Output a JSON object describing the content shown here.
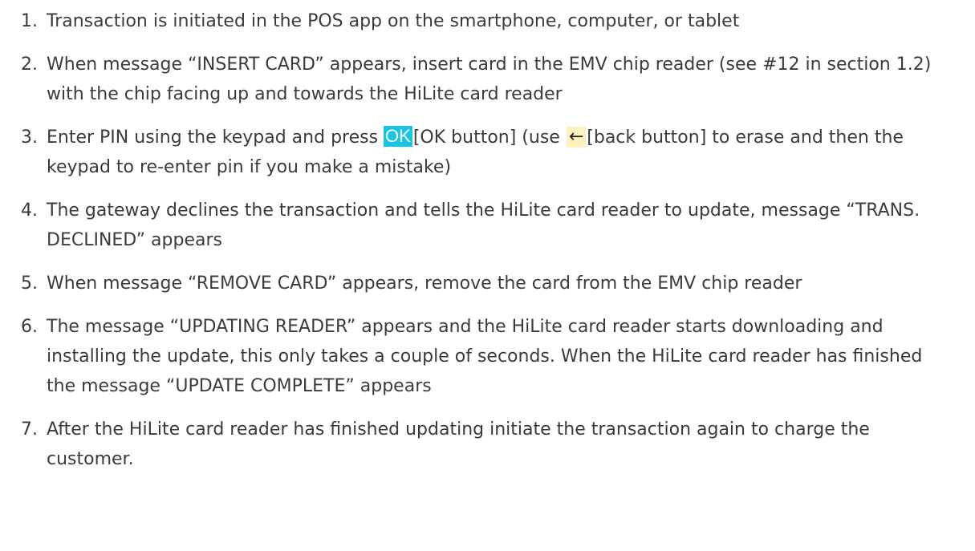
{
  "steps": [
    {
      "number": "1.",
      "text": "Transaction is initiated in the POS app on the smartphone, computer, or tablet"
    },
    {
      "number": "2.",
      "text": "When message “INSERT CARD” appears, insert card in the EMV chip reader (see #12 in section 1.2)  with the chip facing up and towards the HiLite card reader"
    },
    {
      "number": "3.",
      "text_before_ok": "Enter PIN using the keypad and press ",
      "ok_icon_label": "OK",
      "text_after_ok": "[OK button] (use",
      "back_icon_glyph": "←",
      "text_after_back": "[back button] to erase and then the keypad to re-enter pin if you make a mistake)"
    },
    {
      "number": "4.",
      "text": "The gateway declines the transaction and tells the HiLite card reader to update, message “TRANS. DECLINED” appears"
    },
    {
      "number": "5.",
      "text": "When message “REMOVE CARD” appears, remove the card from the EMV chip reader"
    },
    {
      "number": "6.",
      "text": "The message “UPDATING READER” appears and the HiLite card reader starts downloading and installing the update, this only takes a couple of seconds. When the HiLite card reader has finished the message “UPDATE COMPLETE” appears"
    },
    {
      "number": "7.",
      "text": "After the HiLite card reader has finished updating initiate the transaction again to charge the customer."
    }
  ],
  "colors": {
    "text": "#3b3b3b",
    "ok_icon_bg": "#16c6e4",
    "back_icon_bg": "#fff1bf"
  },
  "icons": {
    "ok": "ok-button-icon",
    "back": "back-arrow-icon"
  }
}
